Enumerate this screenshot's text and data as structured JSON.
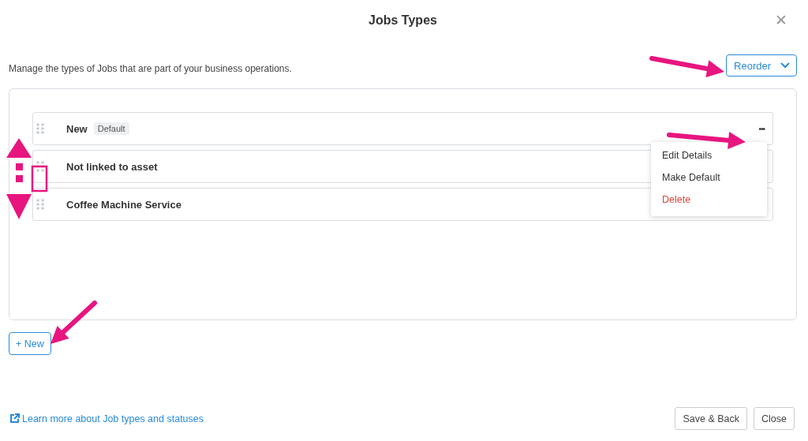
{
  "dialog": {
    "title": "Jobs Types",
    "close_label": "✕"
  },
  "description": "Manage the types of Jobs that are part of your business operations.",
  "reorder_button": {
    "label": "Reorder"
  },
  "job_types": [
    {
      "name": "New",
      "badge": "Default",
      "actions_shown": true
    },
    {
      "name": "Not linked to asset",
      "actions_shown": false
    },
    {
      "name": "Coffee Machine Service",
      "actions_shown": false
    }
  ],
  "actions_menu": {
    "trigger": "•••",
    "items": [
      {
        "label": "Edit Details",
        "kind": "normal"
      },
      {
        "label": "Make Default",
        "kind": "normal"
      },
      {
        "label": "Delete",
        "kind": "danger"
      }
    ]
  },
  "new_button": {
    "label": "+ New"
  },
  "help_link": {
    "label": "Learn more about Job types and statuses"
  },
  "footer_buttons": [
    {
      "label": "Save & Back"
    },
    {
      "label": "Close"
    }
  ]
}
